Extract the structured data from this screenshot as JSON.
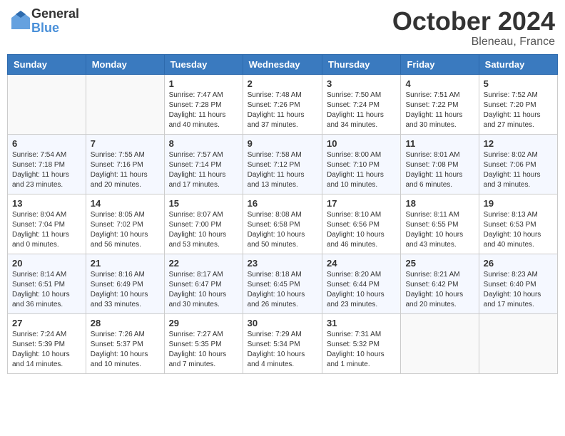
{
  "header": {
    "logo_general": "General",
    "logo_blue": "Blue",
    "month": "October 2024",
    "location": "Bleneau, France"
  },
  "weekdays": [
    "Sunday",
    "Monday",
    "Tuesday",
    "Wednesday",
    "Thursday",
    "Friday",
    "Saturday"
  ],
  "weeks": [
    [
      {
        "day": "",
        "info": ""
      },
      {
        "day": "",
        "info": ""
      },
      {
        "day": "1",
        "info": "Sunrise: 7:47 AM\nSunset: 7:28 PM\nDaylight: 11 hours and 40 minutes."
      },
      {
        "day": "2",
        "info": "Sunrise: 7:48 AM\nSunset: 7:26 PM\nDaylight: 11 hours and 37 minutes."
      },
      {
        "day": "3",
        "info": "Sunrise: 7:50 AM\nSunset: 7:24 PM\nDaylight: 11 hours and 34 minutes."
      },
      {
        "day": "4",
        "info": "Sunrise: 7:51 AM\nSunset: 7:22 PM\nDaylight: 11 hours and 30 minutes."
      },
      {
        "day": "5",
        "info": "Sunrise: 7:52 AM\nSunset: 7:20 PM\nDaylight: 11 hours and 27 minutes."
      }
    ],
    [
      {
        "day": "6",
        "info": "Sunrise: 7:54 AM\nSunset: 7:18 PM\nDaylight: 11 hours and 23 minutes."
      },
      {
        "day": "7",
        "info": "Sunrise: 7:55 AM\nSunset: 7:16 PM\nDaylight: 11 hours and 20 minutes."
      },
      {
        "day": "8",
        "info": "Sunrise: 7:57 AM\nSunset: 7:14 PM\nDaylight: 11 hours and 17 minutes."
      },
      {
        "day": "9",
        "info": "Sunrise: 7:58 AM\nSunset: 7:12 PM\nDaylight: 11 hours and 13 minutes."
      },
      {
        "day": "10",
        "info": "Sunrise: 8:00 AM\nSunset: 7:10 PM\nDaylight: 11 hours and 10 minutes."
      },
      {
        "day": "11",
        "info": "Sunrise: 8:01 AM\nSunset: 7:08 PM\nDaylight: 11 hours and 6 minutes."
      },
      {
        "day": "12",
        "info": "Sunrise: 8:02 AM\nSunset: 7:06 PM\nDaylight: 11 hours and 3 minutes."
      }
    ],
    [
      {
        "day": "13",
        "info": "Sunrise: 8:04 AM\nSunset: 7:04 PM\nDaylight: 11 hours and 0 minutes."
      },
      {
        "day": "14",
        "info": "Sunrise: 8:05 AM\nSunset: 7:02 PM\nDaylight: 10 hours and 56 minutes."
      },
      {
        "day": "15",
        "info": "Sunrise: 8:07 AM\nSunset: 7:00 PM\nDaylight: 10 hours and 53 minutes."
      },
      {
        "day": "16",
        "info": "Sunrise: 8:08 AM\nSunset: 6:58 PM\nDaylight: 10 hours and 50 minutes."
      },
      {
        "day": "17",
        "info": "Sunrise: 8:10 AM\nSunset: 6:56 PM\nDaylight: 10 hours and 46 minutes."
      },
      {
        "day": "18",
        "info": "Sunrise: 8:11 AM\nSunset: 6:55 PM\nDaylight: 10 hours and 43 minutes."
      },
      {
        "day": "19",
        "info": "Sunrise: 8:13 AM\nSunset: 6:53 PM\nDaylight: 10 hours and 40 minutes."
      }
    ],
    [
      {
        "day": "20",
        "info": "Sunrise: 8:14 AM\nSunset: 6:51 PM\nDaylight: 10 hours and 36 minutes."
      },
      {
        "day": "21",
        "info": "Sunrise: 8:16 AM\nSunset: 6:49 PM\nDaylight: 10 hours and 33 minutes."
      },
      {
        "day": "22",
        "info": "Sunrise: 8:17 AM\nSunset: 6:47 PM\nDaylight: 10 hours and 30 minutes."
      },
      {
        "day": "23",
        "info": "Sunrise: 8:18 AM\nSunset: 6:45 PM\nDaylight: 10 hours and 26 minutes."
      },
      {
        "day": "24",
        "info": "Sunrise: 8:20 AM\nSunset: 6:44 PM\nDaylight: 10 hours and 23 minutes."
      },
      {
        "day": "25",
        "info": "Sunrise: 8:21 AM\nSunset: 6:42 PM\nDaylight: 10 hours and 20 minutes."
      },
      {
        "day": "26",
        "info": "Sunrise: 8:23 AM\nSunset: 6:40 PM\nDaylight: 10 hours and 17 minutes."
      }
    ],
    [
      {
        "day": "27",
        "info": "Sunrise: 7:24 AM\nSunset: 5:39 PM\nDaylight: 10 hours and 14 minutes."
      },
      {
        "day": "28",
        "info": "Sunrise: 7:26 AM\nSunset: 5:37 PM\nDaylight: 10 hours and 10 minutes."
      },
      {
        "day": "29",
        "info": "Sunrise: 7:27 AM\nSunset: 5:35 PM\nDaylight: 10 hours and 7 minutes."
      },
      {
        "day": "30",
        "info": "Sunrise: 7:29 AM\nSunset: 5:34 PM\nDaylight: 10 hours and 4 minutes."
      },
      {
        "day": "31",
        "info": "Sunrise: 7:31 AM\nSunset: 5:32 PM\nDaylight: 10 hours and 1 minute."
      },
      {
        "day": "",
        "info": ""
      },
      {
        "day": "",
        "info": ""
      }
    ]
  ]
}
